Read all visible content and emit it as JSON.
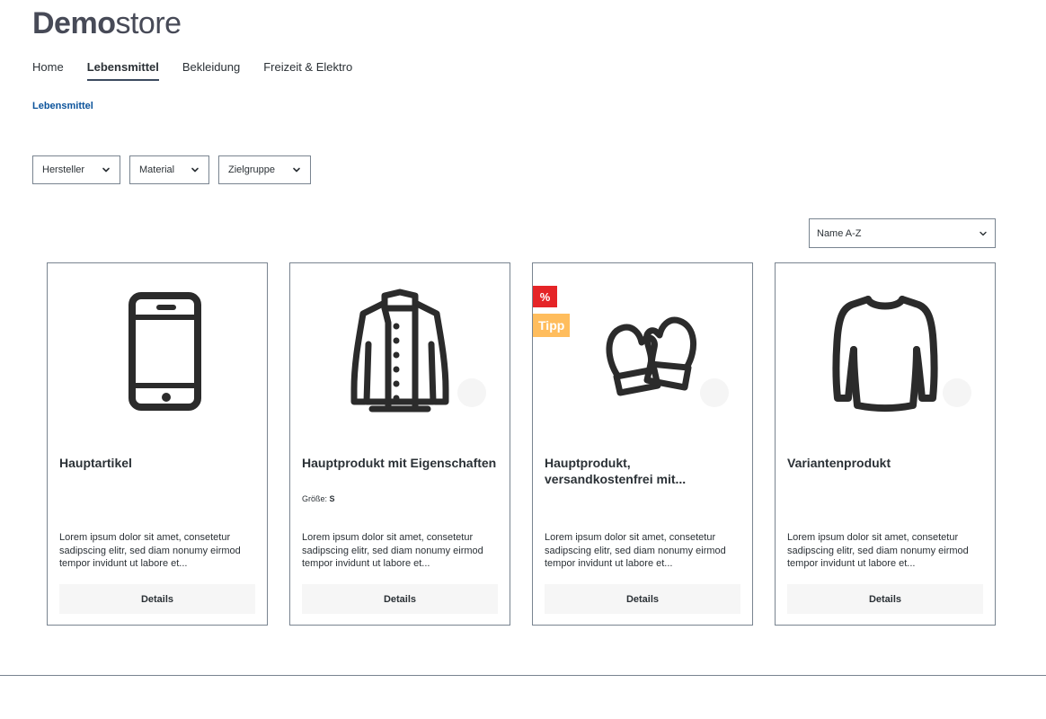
{
  "logo": {
    "bold": "Demo",
    "light": "store"
  },
  "nav": [
    {
      "label": "Home",
      "active": false
    },
    {
      "label": "Lebensmittel",
      "active": true
    },
    {
      "label": "Bekleidung",
      "active": false
    },
    {
      "label": "Freizeit & Elektro",
      "active": false
    }
  ],
  "breadcrumb": {
    "current": "Lebensmittel"
  },
  "filters": [
    {
      "label": "Hersteller",
      "icon": "chevron-down-icon"
    },
    {
      "label": "Material",
      "icon": "chevron-down-icon"
    },
    {
      "label": "Zielgruppe",
      "icon": "chevron-down-icon"
    }
  ],
  "sorting": {
    "selected": "Name A-Z",
    "icon": "chevron-down-icon"
  },
  "products": [
    {
      "title": "Hauptartikel",
      "image_icon": "smartphone-icon",
      "wishlist": false,
      "description": "Lorem ipsum dolor sit amet, consetetur sadipscing elitr, sed diam nonumy eirmod tempor invidunt ut labore et...",
      "button": "Details"
    },
    {
      "title": "Hauptprodukt mit Eigenschaften",
      "image_icon": "jacket-icon",
      "wishlist": true,
      "property": {
        "label": "Größe:",
        "value": "S"
      },
      "description": "Lorem ipsum dolor sit amet, consetetur sadipscing elitr, sed diam nonumy eirmod tempor invidunt ut labore et...",
      "button": "Details"
    },
    {
      "title": "Hauptprodukt, versandkostenfrei mit...",
      "image_icon": "mittens-icon",
      "wishlist": true,
      "badges": {
        "discount": "%",
        "tip": "Tipp"
      },
      "description": "Lorem ipsum dolor sit amet, consetetur sadipscing elitr, sed diam nonumy eirmod tempor invidunt ut labore et...",
      "button": "Details"
    },
    {
      "title": "Variantenprodukt",
      "image_icon": "sweater-icon",
      "wishlist": true,
      "description": "Lorem ipsum dolor sit amet, consetetur sadipscing elitr, sed diam nonumy eirmod tempor invidunt ut labore et...",
      "button": "Details"
    }
  ],
  "colors": {
    "text": "#2b3136",
    "logo": "#474a57",
    "breadcrumb": "#0b539b",
    "border": "#798490",
    "badge_discount": "#e52427",
    "badge_tip": "#ffbd5d",
    "button_bg": "#f6f6f6"
  }
}
